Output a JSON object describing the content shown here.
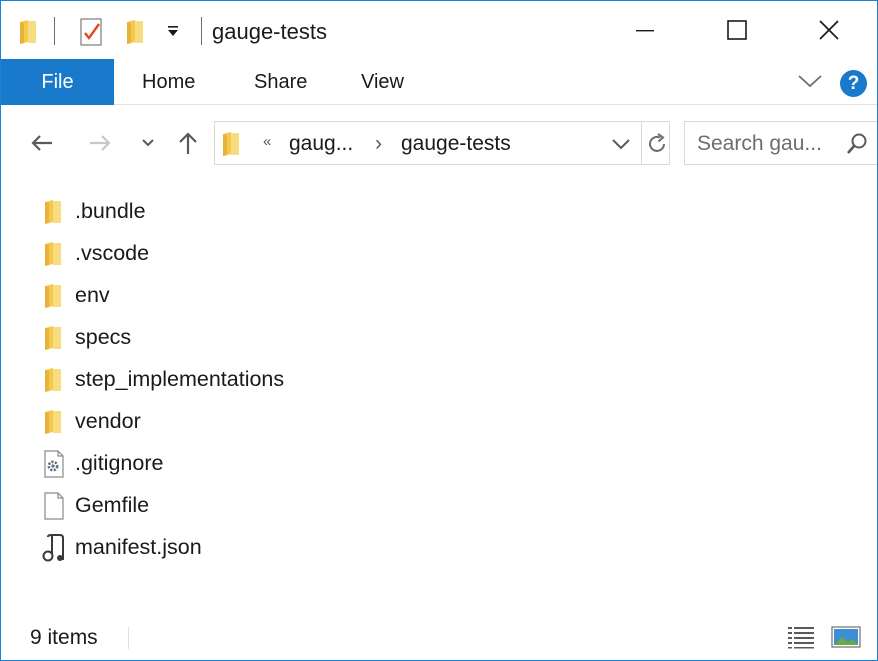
{
  "window": {
    "title": "gauge-tests"
  },
  "quick_access": {
    "icons": [
      "folder-icon",
      "properties-check-icon",
      "new-folder-icon",
      "customize-dropdown-icon"
    ]
  },
  "window_controls": [
    "minimize-icon",
    "maximize-icon",
    "close-icon"
  ],
  "ribbon": {
    "tabs": [
      {
        "label": "File",
        "active": true
      },
      {
        "label": "Home"
      },
      {
        "label": "Share"
      },
      {
        "label": "View"
      }
    ],
    "help_label": "?"
  },
  "navigation": {
    "back_icon": "arrow-left-icon",
    "forward_icon": "arrow-right-icon",
    "recent_icon": "chevron-down-icon",
    "up_icon": "arrow-up-icon",
    "address": {
      "overflow": "«",
      "segments": [
        "gaug...",
        "gauge-tests"
      ],
      "separator": "›"
    },
    "search": {
      "placeholder": "Search gau..."
    }
  },
  "files": [
    {
      "name": ".bundle",
      "icon": "folder-icon"
    },
    {
      "name": ".vscode",
      "icon": "folder-icon"
    },
    {
      "name": "env",
      "icon": "folder-icon"
    },
    {
      "name": "specs",
      "icon": "folder-icon"
    },
    {
      "name": "step_implementations",
      "icon": "folder-icon"
    },
    {
      "name": "vendor",
      "icon": "folder-icon"
    },
    {
      "name": ".gitignore",
      "icon": "settings-file-icon"
    },
    {
      "name": "Gemfile",
      "icon": "blank-file-icon"
    },
    {
      "name": "manifest.json",
      "icon": "music-file-icon"
    }
  ],
  "status": {
    "item_count": "9 items"
  },
  "colors": {
    "accent": "#1979ca",
    "border": "#1883d7",
    "folder": "#f4c94d"
  }
}
